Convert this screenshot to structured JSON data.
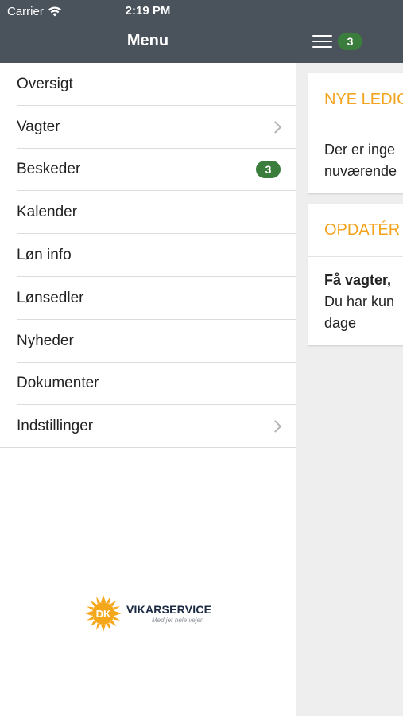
{
  "status_bar": {
    "carrier": "Carrier",
    "time": "2:19 PM"
  },
  "menu": {
    "title": "Menu",
    "items": [
      {
        "label": "Oversigt"
      },
      {
        "label": "Vagter"
      },
      {
        "label": "Beskeder",
        "badge": "3"
      },
      {
        "label": "Kalender"
      },
      {
        "label": "Løn info"
      },
      {
        "label": "Lønsedler"
      },
      {
        "label": "Nyheder"
      },
      {
        "label": "Dokumenter"
      },
      {
        "label": "Indstillinger"
      }
    ]
  },
  "logo": {
    "mark": "DK",
    "name": "VIKARSERVICE",
    "slogan": "Med jer hele vejen"
  },
  "content": {
    "nav_badge": "3",
    "cards": [
      {
        "title": "NYE LEDIG",
        "lines": [
          "Der er inge",
          "nuværende"
        ]
      },
      {
        "title": "OPDATÉR",
        "bold": "Få vagter,",
        "lines": [
          "Du har kun",
          "dage"
        ]
      }
    ]
  },
  "colors": {
    "navbar": "#4a525c",
    "badge": "#3a7d3c",
    "accent": "#f3a31d"
  }
}
